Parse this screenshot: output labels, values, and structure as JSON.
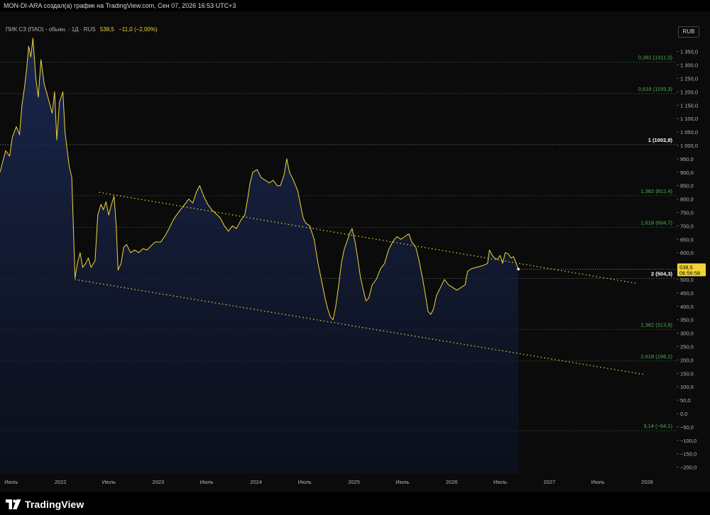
{
  "header": {
    "title": "MON-DI-ARA создал(а) график на TradingView.com, Сен 07, 2026 16:53 UTC+3"
  },
  "legend": {
    "symbol": "ПИК СЗ (ПАО) - обыкн. · 1Д · RUS",
    "price": "538,5",
    "change": "−11,0 (−2,00%)"
  },
  "currency": "RUB",
  "price_label": {
    "price": "538,5",
    "countdown": "06:56:58"
  },
  "brand": {
    "name": "TradingView"
  },
  "colors": {
    "price_line": "#f2d534",
    "fib_label": "#4caf50",
    "fib_line": "#2c5e3a",
    "area": "#131d3a",
    "background": "#0c0c0c"
  },
  "chart_data": {
    "type": "line",
    "title": "ПИК СЗ (ПАО) - обыкн.",
    "xlabel": "",
    "ylabel": "",
    "ylim": [
      -225,
      1500
    ],
    "y_ticks": [
      "1 350,0",
      "1 300,0",
      "1 250,0",
      "1 200,0",
      "1 150,0",
      "1 100,0",
      "1 050,0",
      "1 000,0",
      "950,0",
      "900,0",
      "850,0",
      "800,0",
      "750,0",
      "700,0",
      "650,0",
      "600,0",
      "550,0",
      "500,0",
      "450,0",
      "400,0",
      "350,0",
      "300,0",
      "250,0",
      "200,0",
      "150,0",
      "100,0",
      "50,0",
      "0,0",
      "−50,0",
      "−100,0",
      "−150,0",
      "−200,0"
    ],
    "y_tick_values": [
      1350,
      1300,
      1250,
      1200,
      1150,
      1100,
      1050,
      1000,
      950,
      900,
      850,
      800,
      750,
      700,
      650,
      600,
      550,
      500,
      450,
      400,
      350,
      300,
      250,
      200,
      150,
      100,
      50,
      0,
      -50,
      -100,
      -150,
      -200
    ],
    "x_ticks": [
      {
        "label": "Июль",
        "date": "2021-07-01"
      },
      {
        "label": "2022",
        "date": "2022-01-01"
      },
      {
        "label": "Июль",
        "date": "2022-07-01"
      },
      {
        "label": "2023",
        "date": "2023-01-01"
      },
      {
        "label": "Июль",
        "date": "2023-07-01"
      },
      {
        "label": "2024",
        "date": "2024-01-01"
      },
      {
        "label": "Июль",
        "date": "2024-07-01"
      },
      {
        "label": "2025",
        "date": "2025-01-01"
      },
      {
        "label": "Июль",
        "date": "2025-07-01"
      },
      {
        "label": "2026",
        "date": "2026-01-01"
      },
      {
        "label": "Июль",
        "date": "2026-07-01"
      },
      {
        "label": "2027",
        "date": "2027-01-01"
      },
      {
        "label": "Июль",
        "date": "2027-07-01"
      },
      {
        "label": "2028",
        "date": "2028-01-01"
      }
    ],
    "x_range": [
      "2021-05-20",
      "2028-04-20"
    ],
    "series": [
      {
        "values": [
          [
            "2021-05-20",
            900
          ],
          [
            "2021-06-10",
            980
          ],
          [
            "2021-06-25",
            960
          ],
          [
            "2021-07-05",
            1030
          ],
          [
            "2021-07-20",
            1070
          ],
          [
            "2021-08-01",
            1040
          ],
          [
            "2021-08-10",
            1150
          ],
          [
            "2021-08-20",
            1220
          ],
          [
            "2021-08-28",
            1290
          ],
          [
            "2021-09-04",
            1370
          ],
          [
            "2021-09-12",
            1330
          ],
          [
            "2021-09-20",
            1400
          ],
          [
            "2021-10-01",
            1250
          ],
          [
            "2021-10-10",
            1180
          ],
          [
            "2021-10-20",
            1320
          ],
          [
            "2021-11-01",
            1230
          ],
          [
            "2021-11-15",
            1180
          ],
          [
            "2021-12-01",
            1120
          ],
          [
            "2021-12-10",
            1200
          ],
          [
            "2021-12-18",
            1020
          ],
          [
            "2021-12-28",
            1160
          ],
          [
            "2022-01-10",
            1200
          ],
          [
            "2022-01-18",
            1050
          ],
          [
            "2022-01-26",
            980
          ],
          [
            "2022-02-03",
            920
          ],
          [
            "2022-02-12",
            880
          ],
          [
            "2022-02-18",
            700
          ],
          [
            "2022-02-24",
            505
          ],
          [
            "2022-03-05",
            560
          ],
          [
            "2022-03-15",
            600
          ],
          [
            "2022-03-25",
            545
          ],
          [
            "2022-04-05",
            560
          ],
          [
            "2022-04-15",
            580
          ],
          [
            "2022-04-25",
            545
          ],
          [
            "2022-05-10",
            570
          ],
          [
            "2022-05-20",
            740
          ],
          [
            "2022-06-01",
            780
          ],
          [
            "2022-06-10",
            760
          ],
          [
            "2022-06-20",
            790
          ],
          [
            "2022-06-30",
            740
          ],
          [
            "2022-07-10",
            780
          ],
          [
            "2022-07-20",
            810
          ],
          [
            "2022-07-28",
            700
          ],
          [
            "2022-08-04",
            535
          ],
          [
            "2022-08-15",
            560
          ],
          [
            "2022-08-25",
            620
          ],
          [
            "2022-09-05",
            630
          ],
          [
            "2022-09-20",
            600
          ],
          [
            "2022-10-05",
            610
          ],
          [
            "2022-10-20",
            600
          ],
          [
            "2022-11-05",
            615
          ],
          [
            "2022-11-20",
            610
          ],
          [
            "2022-12-05",
            625
          ],
          [
            "2022-12-20",
            640
          ],
          [
            "2023-01-10",
            640
          ],
          [
            "2023-01-25",
            660
          ],
          [
            "2023-02-10",
            690
          ],
          [
            "2023-02-25",
            720
          ],
          [
            "2023-03-10",
            740
          ],
          [
            "2023-03-25",
            760
          ],
          [
            "2023-04-10",
            780
          ],
          [
            "2023-04-25",
            800
          ],
          [
            "2023-05-10",
            785
          ],
          [
            "2023-05-25",
            830
          ],
          [
            "2023-06-05",
            850
          ],
          [
            "2023-06-20",
            810
          ],
          [
            "2023-07-05",
            780
          ],
          [
            "2023-07-20",
            760
          ],
          [
            "2023-08-05",
            745
          ],
          [
            "2023-08-20",
            730
          ],
          [
            "2023-09-05",
            700
          ],
          [
            "2023-09-20",
            680
          ],
          [
            "2023-10-05",
            700
          ],
          [
            "2023-10-20",
            690
          ],
          [
            "2023-11-05",
            720
          ],
          [
            "2023-11-20",
            740
          ],
          [
            "2023-12-01",
            800
          ],
          [
            "2023-12-10",
            860
          ],
          [
            "2023-12-20",
            900
          ],
          [
            "2024-01-05",
            910
          ],
          [
            "2024-01-20",
            880
          ],
          [
            "2024-02-05",
            870
          ],
          [
            "2024-02-20",
            860
          ],
          [
            "2024-03-05",
            870
          ],
          [
            "2024-03-20",
            850
          ],
          [
            "2024-04-01",
            850
          ],
          [
            "2024-04-15",
            890
          ],
          [
            "2024-04-25",
            950
          ],
          [
            "2024-05-05",
            900
          ],
          [
            "2024-05-20",
            870
          ],
          [
            "2024-06-05",
            830
          ],
          [
            "2024-06-15",
            780
          ],
          [
            "2024-06-25",
            730
          ],
          [
            "2024-07-05",
            710
          ],
          [
            "2024-07-20",
            700
          ],
          [
            "2024-08-05",
            650
          ],
          [
            "2024-08-20",
            560
          ],
          [
            "2024-09-01",
            500
          ],
          [
            "2024-09-15",
            430
          ],
          [
            "2024-09-25",
            390
          ],
          [
            "2024-10-05",
            360
          ],
          [
            "2024-10-15",
            350
          ],
          [
            "2024-10-25",
            400
          ],
          [
            "2024-11-05",
            480
          ],
          [
            "2024-11-15",
            560
          ],
          [
            "2024-11-25",
            610
          ],
          [
            "2024-12-05",
            640
          ],
          [
            "2024-12-15",
            670
          ],
          [
            "2024-12-25",
            690
          ],
          [
            "2025-01-05",
            640
          ],
          [
            "2025-01-15",
            580
          ],
          [
            "2025-01-25",
            510
          ],
          [
            "2025-02-05",
            460
          ],
          [
            "2025-02-15",
            420
          ],
          [
            "2025-02-25",
            430
          ],
          [
            "2025-03-10",
            480
          ],
          [
            "2025-03-25",
            500
          ],
          [
            "2025-04-10",
            540
          ],
          [
            "2025-04-25",
            560
          ],
          [
            "2025-05-10",
            610
          ],
          [
            "2025-05-25",
            640
          ],
          [
            "2025-06-10",
            660
          ],
          [
            "2025-06-25",
            650
          ],
          [
            "2025-07-10",
            660
          ],
          [
            "2025-07-25",
            670
          ],
          [
            "2025-08-05",
            640
          ],
          [
            "2025-08-20",
            620
          ],
          [
            "2025-09-01",
            570
          ],
          [
            "2025-09-15",
            500
          ],
          [
            "2025-09-25",
            440
          ],
          [
            "2025-10-05",
            380
          ],
          [
            "2025-10-15",
            370
          ],
          [
            "2025-10-25",
            390
          ],
          [
            "2025-11-05",
            440
          ],
          [
            "2025-11-20",
            470
          ],
          [
            "2025-12-05",
            500
          ],
          [
            "2025-12-20",
            480
          ],
          [
            "2026-01-05",
            470
          ],
          [
            "2026-01-20",
            460
          ],
          [
            "2026-02-05",
            470
          ],
          [
            "2026-02-20",
            480
          ],
          [
            "2026-03-01",
            530
          ],
          [
            "2026-03-15",
            540
          ],
          [
            "2026-04-01",
            545
          ],
          [
            "2026-04-20",
            550
          ],
          [
            "2026-05-05",
            555
          ],
          [
            "2026-05-15",
            560
          ],
          [
            "2026-05-22",
            610
          ],
          [
            "2026-06-01",
            590
          ],
          [
            "2026-06-10",
            580
          ],
          [
            "2026-06-20",
            575
          ],
          [
            "2026-07-01",
            590
          ],
          [
            "2026-07-10",
            560
          ],
          [
            "2026-07-20",
            600
          ],
          [
            "2026-08-01",
            595
          ],
          [
            "2026-08-10",
            580
          ],
          [
            "2026-08-20",
            585
          ],
          [
            "2026-08-30",
            560
          ],
          [
            "2026-09-07",
            538.5
          ]
        ]
      }
    ],
    "fib_levels": [
      {
        "label": "0,382 (1311,0)",
        "value": 1311.0
      },
      {
        "label": "0,618 (1193,3)",
        "value": 1193.3
      },
      {
        "label": "1 (1002,8)",
        "value": 1002.8,
        "emphasis": true
      },
      {
        "label": "1,382 (812,4)",
        "value": 812.4
      },
      {
        "label": "1,618 (694,7)",
        "value": 694.7
      },
      {
        "label": "2 (504,3)",
        "value": 504.3,
        "emphasis": true
      },
      {
        "label": "2,382 (313,8)",
        "value": 313.8
      },
      {
        "label": "2,618 (196,1)",
        "value": 196.1
      },
      {
        "label": "3,14 (−64,1)",
        "value": -64.1
      }
    ],
    "trendlines": [
      {
        "from": [
          "2022-05-25",
          825
        ],
        "to": [
          "2027-11-25",
          485
        ]
      },
      {
        "from": [
          "2022-02-24",
          500
        ],
        "to": [
          "2027-12-25",
          145
        ]
      }
    ],
    "current_price": 538.5,
    "grid": true,
    "legend": "top-left"
  }
}
